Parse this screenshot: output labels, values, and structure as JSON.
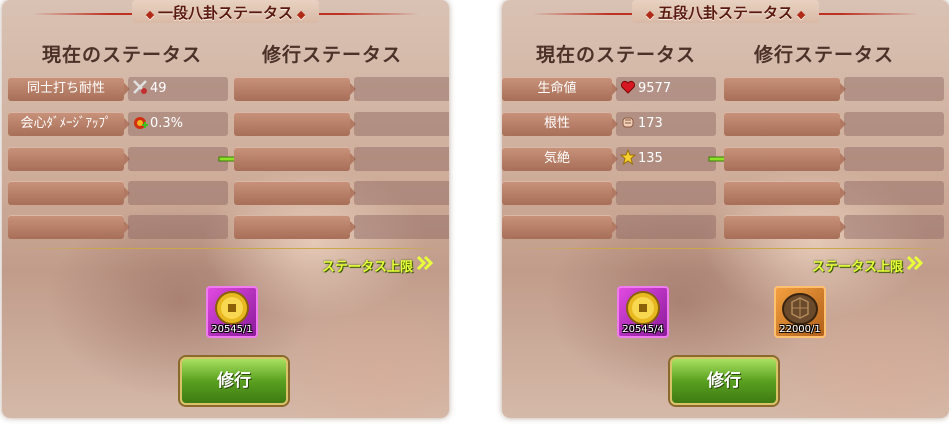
{
  "left_panel": {
    "title": "一段八卦ステータス",
    "current_header": "現在のステータス",
    "training_header": "修行ステータス",
    "stats": [
      {
        "label": "同士打ち耐性",
        "icon": "crossed-swords-icon",
        "value": "49"
      },
      {
        "label": "会心ﾀﾞﾒｰｼﾞｱｯﾌﾟ",
        "icon": "flame-plus-icon",
        "value": "0.3%"
      }
    ],
    "limit_text": "ステータス上限",
    "items": [
      {
        "icon": "gold-coin-icon",
        "count": "20545/1"
      }
    ],
    "button_label": "修行"
  },
  "right_panel": {
    "title": "五段八卦ステータス",
    "current_header": "現在のステータス",
    "training_header": "修行ステータス",
    "stats": [
      {
        "label": "生命値",
        "icon": "heart-icon",
        "value": "9577"
      },
      {
        "label": "根性",
        "icon": "fist-icon",
        "value": "173"
      },
      {
        "label": "気絶",
        "icon": "star-icon",
        "value": "135"
      }
    ],
    "limit_text": "ステータス上限",
    "items": [
      {
        "icon": "gold-coin-icon",
        "count": "20545/4"
      },
      {
        "icon": "turtle-shell-icon",
        "count": "22000/1"
      }
    ],
    "button_label": "修行"
  },
  "colors": {
    "accent_green": "#5aa020",
    "limit_text": "#e8ff3a",
    "label_pill": "#b27a62",
    "title_red": "#c03020"
  }
}
